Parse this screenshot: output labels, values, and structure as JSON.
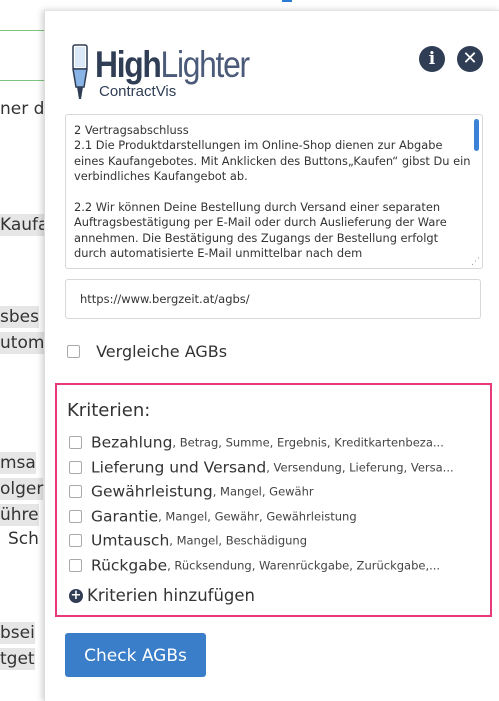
{
  "background_page": {
    "fragments": [
      "ner d",
      "Kaufa",
      "sbes",
      "utom",
      "msa",
      "olger",
      "ühre",
      "Sch",
      "bsei",
      "tget"
    ]
  },
  "popup": {
    "logo": {
      "title_bold": "High",
      "title_light": "Lighter",
      "subtitle": "ContractVis"
    },
    "header_icons": {
      "info": "info-icon",
      "close": "close-icon"
    },
    "agb_text": "2 Vertragsabschluss\n2.1 Die Produktdarstellungen im Online-Shop dienen zur Abgabe eines Kaufangebotes. Mit Anklicken des Buttons„Kaufen“ gibst Du ein verbindliches Kaufangebot ab.\n\n2.2 Wir können Deine Bestellung durch Versand einer separaten Auftragsbestätigung per E-Mail oder durch Auslieferung der Ware annehmen. Die Bestätigung des Zugangs der Bestellung erfolgt durch automatisierte E-Mail unmittelbar nach dem",
    "url_value": "https://www.bergzeit.at/agbs/",
    "compare_label": "Vergleiche AGBs",
    "criteria": {
      "title": "Kriterien:",
      "items": [
        {
          "name": "Bezahlung",
          "keywords": ", Betrag, Summe, Ergebnis, Kreditkartenbeza..."
        },
        {
          "name": "Lieferung und Versand",
          "keywords": ", Versendung, Lieferung, Versa..."
        },
        {
          "name": "Gewährleistung",
          "keywords": ", Mangel, Gewähr"
        },
        {
          "name": "Garantie",
          "keywords": ", Mangel, Gewähr, Gewährleistung"
        },
        {
          "name": "Umtausch",
          "keywords": ", Mangel, Beschädigung"
        },
        {
          "name": "Rückgabe",
          "keywords": ", Rücksendung, Warenrückgabe, Zurückgabe,..."
        }
      ],
      "add_label": "Kriterien hinzufügen"
    },
    "check_button": "Check AGBs"
  },
  "colors": {
    "accent": "#3a7dc9",
    "brand_dark": "#2f3d55",
    "criteria_border": "#e8397a"
  }
}
